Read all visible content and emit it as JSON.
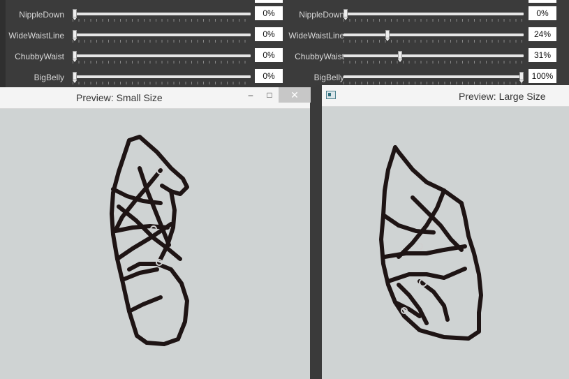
{
  "sliders_left": [
    {
      "label": "NippleDown",
      "value": "0%",
      "level": 0
    },
    {
      "label": "WideWaistLine",
      "value": "0%",
      "level": 0
    },
    {
      "label": "ChubbyWaist",
      "value": "0%",
      "level": 0
    },
    {
      "label": "BigBelly",
      "value": "0%",
      "level": 0
    }
  ],
  "sliders_right": [
    {
      "label": "NippleDown",
      "value": "0%",
      "level": 0
    },
    {
      "label": "WideWaistLine",
      "value": "24%",
      "level": 24
    },
    {
      "label": "ChubbyWaist",
      "value": "31%",
      "level": 31
    },
    {
      "label": "BigBelly",
      "value": "100%",
      "level": 100
    }
  ],
  "preview_small": {
    "title": "Preview: Small Size",
    "min_glyph": "–",
    "max_glyph": "□",
    "close_glyph": "✕"
  },
  "preview_large": {
    "title": "Preview: Large Size"
  },
  "colors": {
    "panel_bg": "#3b3b3b",
    "preview_bg": "#cfd3d3",
    "strap": "#1e1414"
  }
}
